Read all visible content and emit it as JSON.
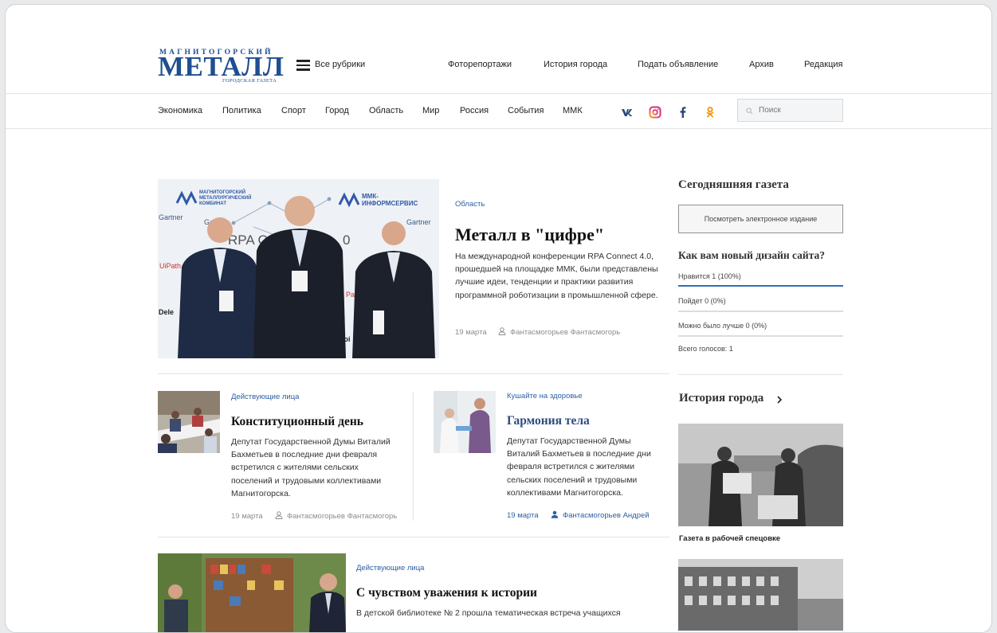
{
  "header": {
    "logo_top": "МАГНИТОГОРСКИЙ",
    "logo_main": "МЕТАЛЛ",
    "logo_sub": "ГОРОДСКАЯ ГАЗЕТА",
    "rubrics_label": "Все рубрики",
    "nav": [
      "Фоторепортажи",
      "История города",
      "Подать объявление",
      "Архив",
      "Редакция"
    ]
  },
  "categories": [
    "Экономика",
    "Политика",
    "Спорт",
    "Город",
    "Область",
    "Мир",
    "Россия",
    "События",
    "ММК"
  ],
  "social_icons": [
    "vk-icon",
    "instagram-icon",
    "facebook-icon",
    "odnoklassniki-icon"
  ],
  "search": {
    "placeholder": "Поиск"
  },
  "hero_photo": {
    "logo_left": [
      "МАГНИТОГОРСКИЙ",
      "МЕТАЛЛУРГИЧЕСКИЙ",
      "КОМБИНАТ"
    ],
    "logo_right": [
      "ММК-",
      "ИНФОРМСЕРВИС"
    ],
    "wall_text": [
      "Gartner",
      "Gartner",
      "Gartner",
      "RPA C",
      "0",
      "UiPath",
      "Dele",
      "eloi",
      "Path"
    ]
  },
  "main_article": {
    "tag": "Область",
    "title": "Металл в \"цифре\"",
    "lead": "На международной конференции RPA Connect 4.0, прошедшей на площадке ММК, были представлены лучшие идеи, тенденции и практики развития программной роботизации в промышленной сфере.",
    "date": "19 марта",
    "author": "Фантасмогорьев Фантасмогорь"
  },
  "articles": [
    {
      "tag": "Действующие лица",
      "title": "Конституционный день",
      "lead": "Депутат Государственной Думы Виталий Бахметьев в последние дни февраля встретился с жителями сельских поселений и трудовыми коллективами Магнитогорска.",
      "date": "19 марта",
      "author": "Фантасмогорьев Фантасмогорь"
    },
    {
      "tag": "Кушайте на здоровье",
      "title": "Гармония тела",
      "lead": "Депутат Государственной Думы Виталий Бахметьев в последние дни февраля встретился с жителями сельских поселений и трудовыми коллективами Магнитогорска.",
      "date": "19 марта",
      "author": "Фантасмогорьев Андрей"
    },
    {
      "tag": "Действующие лица",
      "title": "С чувством уважения к истории",
      "lead": "В детской библиотеке № 2 прошла тематическая встреча учащихся"
    }
  ],
  "sidebar": {
    "today_title": "Сегодняшняя газета",
    "today_button": "Посмотреть электронное издание",
    "poll_title": "Как вам новый дизайн сайта?",
    "poll_options": [
      {
        "label": "Нравится 1 (100%)",
        "share": 1.0
      },
      {
        "label": "Пойдет 0 (0%)",
        "share": 0.0
      },
      {
        "label": "Можно было лучше 0 (0%)",
        "share": 0.0
      }
    ],
    "poll_total": "Всего голосов: 1",
    "history_title": "История города",
    "history_caption": "Газета в рабочей спецовке"
  },
  "colors": {
    "brand_blue": "#1f4e91",
    "link_blue": "#2c5fa0",
    "poll_blue": "#2f6fb5"
  }
}
